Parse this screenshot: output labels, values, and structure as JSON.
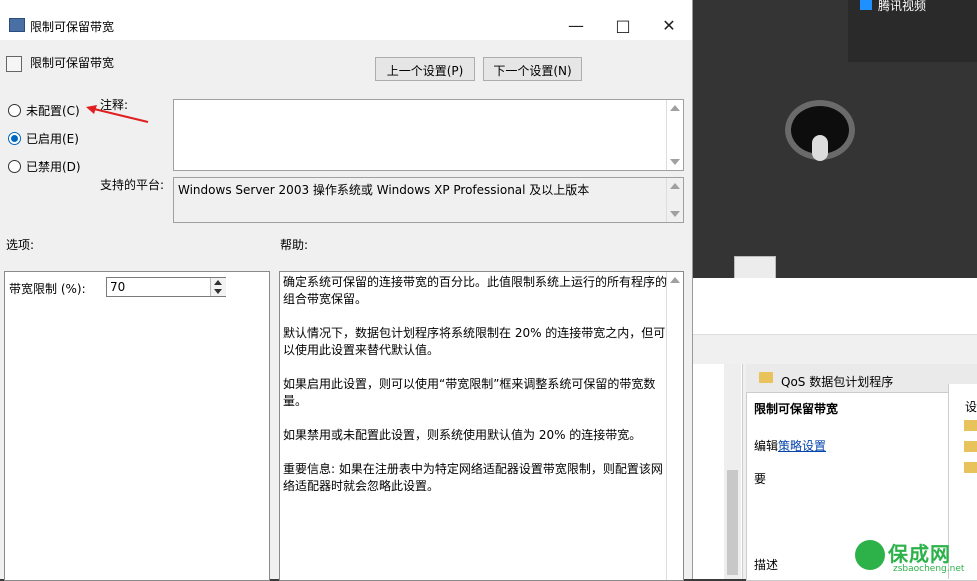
{
  "window": {
    "title": "限制可保留带宽",
    "minimize_icon": "minimize-icon",
    "maximize_icon": "maximize-icon",
    "close_icon": "close-icon"
  },
  "header": {
    "setting_name": "限制可保留带宽",
    "prev_button": "上一个设置(P)",
    "next_button": "下一个设置(N)"
  },
  "state": {
    "options": [
      {
        "label": "未配置(C)",
        "checked": false
      },
      {
        "label": "已启用(E)",
        "checked": true
      },
      {
        "label": "已禁用(D)",
        "checked": false
      }
    ]
  },
  "comment": {
    "label": "注释:",
    "value": ""
  },
  "platform": {
    "label": "支持的平台:",
    "value": "Windows Server 2003 操作系统或 Windows XP Professional 及以上版本"
  },
  "options_panel": {
    "heading": "选项:",
    "bandwidth_label": "带宽限制 (%):",
    "bandwidth_value": "70"
  },
  "help_panel": {
    "heading": "帮助:",
    "paragraphs": [
      "确定系统可保留的连接带宽的百分比。此值限制系统上运行的所有程序的组合带宽保留。",
      "默认情况下，数据包计划程序将系统限制在 20% 的连接带宽之内，但可以使用此设置来替代默认值。",
      "如果启用此设置，则可以使用“带宽限制”框来调整系统可保留的带宽数量。",
      "如果禁用或未配置此设置，则系统使用默认值为 20% 的连接带宽。",
      "重要信息: 如果在注册表中为特定网络适配器设置带宽限制，则配置该网络适配器时就会忽略此设置。"
    ]
  },
  "background": {
    "video_app_label": "腾讯视频",
    "desc_header": "QoS 数据包计划程序",
    "desc_title": "限制可保留带宽",
    "desc_edit_prefix": "编辑",
    "desc_edit_link": "策略设置",
    "desc_requirements": "要",
    "desc_description": "描述",
    "side_label": "设"
  },
  "watermark": {
    "text": "保成网",
    "url": "zsbaocheng.net"
  },
  "colors": {
    "accent": "#0067c0",
    "arrow": "#e02020",
    "watermark": "#2db24a"
  }
}
